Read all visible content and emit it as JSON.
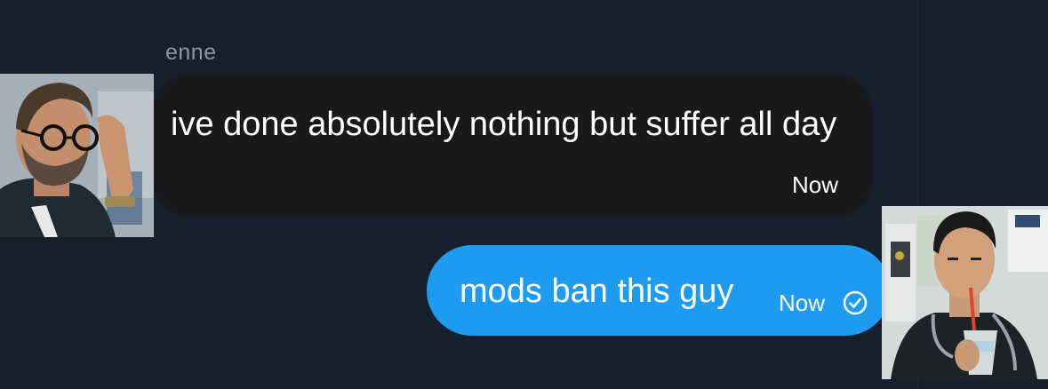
{
  "conversation": {
    "incoming": {
      "sender_name": "enne",
      "avatar_icon": "user-avatar-photo",
      "text": "ive done absolutely nothing but suffer all day",
      "time": "Now"
    },
    "outgoing": {
      "avatar_icon": "user-avatar-photo",
      "text": "mods ban this guy",
      "time": "Now",
      "status_icon": "seen-check-icon"
    }
  },
  "colors": {
    "background": "#16202c",
    "incoming_bubble": "#19191b",
    "outgoing_bubble": "#1d9bf0",
    "sender_name": "#8b96a3",
    "text": "#ffffff"
  }
}
